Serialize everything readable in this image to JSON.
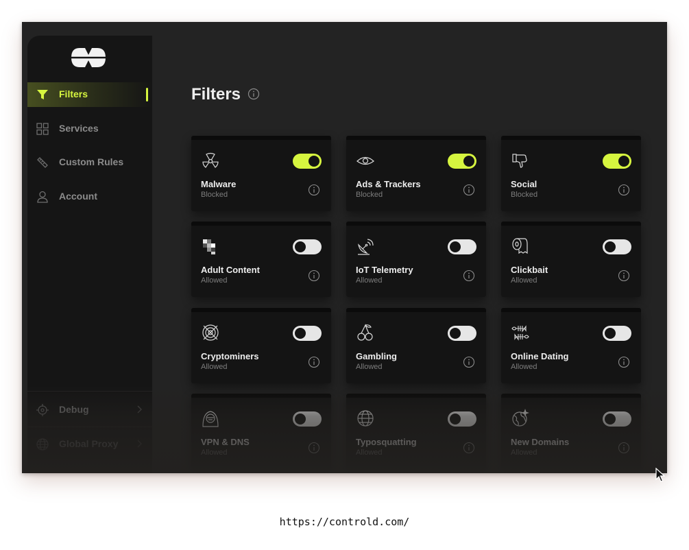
{
  "sidebar": {
    "items": [
      {
        "label": "Filters",
        "active": true
      },
      {
        "label": "Services"
      },
      {
        "label": "Custom Rules"
      },
      {
        "label": "Account"
      },
      {
        "label": "Debug"
      },
      {
        "label": "Global Proxy"
      }
    ]
  },
  "main": {
    "title": "Filters"
  },
  "filters": [
    {
      "name": "Malware",
      "status": "Blocked",
      "enabled": true,
      "icon": "radiation-icon"
    },
    {
      "name": "Ads & Trackers",
      "status": "Blocked",
      "enabled": true,
      "icon": "eye-icon"
    },
    {
      "name": "Social",
      "status": "Blocked",
      "enabled": true,
      "icon": "thumbs-down-icon"
    },
    {
      "name": "Adult Content",
      "status": "Allowed",
      "enabled": false,
      "icon": "pixelated-icon"
    },
    {
      "name": "IoT Telemetry",
      "status": "Allowed",
      "enabled": false,
      "icon": "satellite-dish-icon"
    },
    {
      "name": "Clickbait",
      "status": "Allowed",
      "enabled": false,
      "icon": "toilet-paper-icon"
    },
    {
      "name": "Cryptominers",
      "status": "Allowed",
      "enabled": false,
      "icon": "crypto-coin-icon"
    },
    {
      "name": "Gambling",
      "status": "Allowed",
      "enabled": false,
      "icon": "cherries-icon"
    },
    {
      "name": "Online Dating",
      "status": "Allowed",
      "enabled": false,
      "icon": "fish-bones-icon"
    },
    {
      "name": "VPN & DNS",
      "status": "Allowed",
      "enabled": false,
      "icon": "hooded-agent-icon"
    },
    {
      "name": "Typosquatting",
      "status": "Allowed",
      "enabled": false,
      "icon": "globe-icon"
    },
    {
      "name": "New Domains",
      "status": "Allowed",
      "enabled": false,
      "icon": "new-globe-icon"
    }
  ],
  "colors": {
    "accent": "#d6f53f",
    "background": "#232323",
    "sidebar": "#151515",
    "card": "#141414"
  },
  "footer": {
    "url": "https://controld.com/"
  }
}
